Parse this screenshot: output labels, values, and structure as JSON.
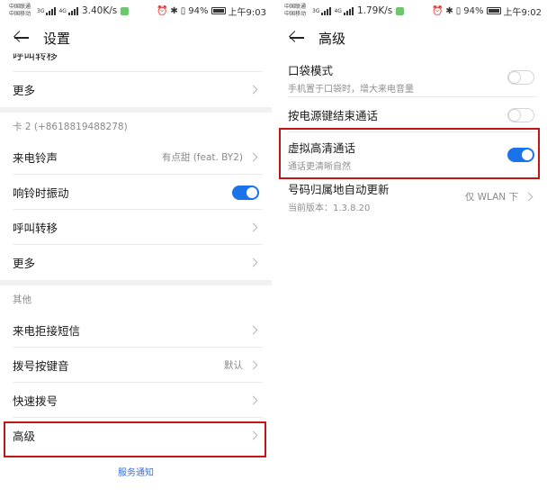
{
  "left": {
    "status": {
      "carrier1": "中国联通",
      "carrier2": "中国移动",
      "sig1": "3G",
      "sig2": "4G",
      "speed": "3.40K/s",
      "battery": "94%",
      "time": "上午9:03"
    },
    "header": {
      "title": "设置"
    },
    "rows_top": [
      {
        "label": "呼叫转移"
      },
      {
        "label": "更多"
      }
    ],
    "card2": {
      "section_label": "卡 2 (+8618819488278)",
      "ringtone_label": "来电铃声",
      "ringtone_value": "有点甜 (feat. BY2)",
      "vibrate_label": "响铃时振动",
      "forward_label": "呼叫转移",
      "more_label": "更多"
    },
    "other": {
      "section_label": "其他",
      "reject_sms": "来电拒接短信",
      "dialpad_tone": "拨号按键音",
      "dialpad_tone_value": "默认",
      "speed_dial": "快速拨号",
      "advanced": "高级"
    },
    "footer_link": "服务通知"
  },
  "right": {
    "status": {
      "carrier1": "中国联通",
      "carrier2": "中国移动",
      "sig1": "3G",
      "sig2": "4G",
      "speed": "1.79K/s",
      "battery": "94%",
      "time": "上午9:02"
    },
    "header": {
      "title": "高级"
    },
    "pocket": {
      "label": "口袋模式",
      "sub": "手机置于口袋时，增大来电音量"
    },
    "power_end": {
      "label": "按电源键结束通话"
    },
    "hd_call": {
      "label": "虚拟高清通话",
      "sub": "通话更清晰自然"
    },
    "location": {
      "label": "号码归属地自动更新",
      "sub": "当前版本：1.3.8.20",
      "value": "仅 WLAN 下"
    }
  },
  "colors": {
    "accent": "#1a73e8",
    "highlight": "#c41515",
    "link": "#3a6fd8"
  }
}
